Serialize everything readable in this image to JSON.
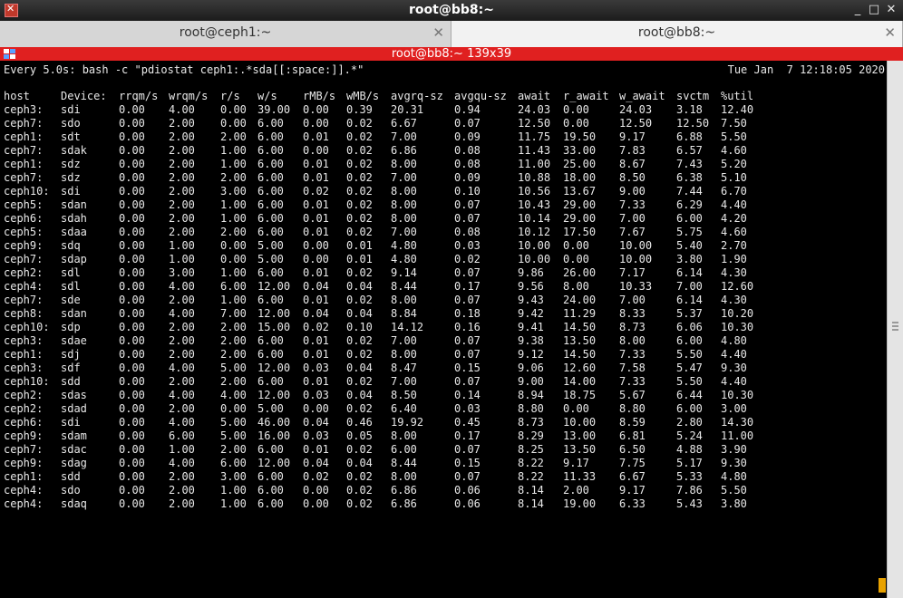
{
  "window": {
    "title": "root@bb8:~"
  },
  "tabs": [
    {
      "label": "root@ceph1:~",
      "active": false
    },
    {
      "label": "root@bb8:~",
      "active": true
    }
  ],
  "terminal": {
    "title": "root@bb8:~ 139x39",
    "command": "Every 5.0s: bash -c \"pdiostat ceph1:.*sda[[:space:]].*\"",
    "datetime": "Tue Jan  7 12:18:05 2020",
    "headers": [
      "host",
      "Device:",
      "rrqm/s",
      "wrqm/s",
      "r/s",
      "w/s",
      "rMB/s",
      "wMB/s",
      "avgrq-sz",
      "avgqu-sz",
      "await",
      "r_await",
      "w_await",
      "svctm",
      "%util"
    ],
    "rows": [
      [
        "ceph3:",
        "sdi",
        "0.00",
        "4.00",
        "0.00",
        "39.00",
        "0.00",
        "0.39",
        "20.31",
        "0.94",
        "24.03",
        "0.00",
        "24.03",
        "3.18",
        "12.40"
      ],
      [
        "ceph7:",
        "sdo",
        "0.00",
        "2.00",
        "0.00",
        "6.00",
        "0.00",
        "0.02",
        "6.67",
        "0.07",
        "12.50",
        "0.00",
        "12.50",
        "12.50",
        "7.50"
      ],
      [
        "ceph1:",
        "sdt",
        "0.00",
        "2.00",
        "2.00",
        "6.00",
        "0.01",
        "0.02",
        "7.00",
        "0.09",
        "11.75",
        "19.50",
        "9.17",
        "6.88",
        "5.50"
      ],
      [
        "ceph7:",
        "sdak",
        "0.00",
        "2.00",
        "1.00",
        "6.00",
        "0.00",
        "0.02",
        "6.86",
        "0.08",
        "11.43",
        "33.00",
        "7.83",
        "6.57",
        "4.60"
      ],
      [
        "ceph1:",
        "sdz",
        "0.00",
        "2.00",
        "1.00",
        "6.00",
        "0.01",
        "0.02",
        "8.00",
        "0.08",
        "11.00",
        "25.00",
        "8.67",
        "7.43",
        "5.20"
      ],
      [
        "ceph7:",
        "sdz",
        "0.00",
        "2.00",
        "2.00",
        "6.00",
        "0.01",
        "0.02",
        "7.00",
        "0.09",
        "10.88",
        "18.00",
        "8.50",
        "6.38",
        "5.10"
      ],
      [
        "ceph10:",
        "sdi",
        "0.00",
        "2.00",
        "3.00",
        "6.00",
        "0.02",
        "0.02",
        "8.00",
        "0.10",
        "10.56",
        "13.67",
        "9.00",
        "7.44",
        "6.70"
      ],
      [
        "ceph5:",
        "sdan",
        "0.00",
        "2.00",
        "1.00",
        "6.00",
        "0.01",
        "0.02",
        "8.00",
        "0.07",
        "10.43",
        "29.00",
        "7.33",
        "6.29",
        "4.40"
      ],
      [
        "ceph6:",
        "sdah",
        "0.00",
        "2.00",
        "1.00",
        "6.00",
        "0.01",
        "0.02",
        "8.00",
        "0.07",
        "10.14",
        "29.00",
        "7.00",
        "6.00",
        "4.20"
      ],
      [
        "ceph5:",
        "sdaa",
        "0.00",
        "2.00",
        "2.00",
        "6.00",
        "0.01",
        "0.02",
        "7.00",
        "0.08",
        "10.12",
        "17.50",
        "7.67",
        "5.75",
        "4.60"
      ],
      [
        "ceph9:",
        "sdq",
        "0.00",
        "1.00",
        "0.00",
        "5.00",
        "0.00",
        "0.01",
        "4.80",
        "0.03",
        "10.00",
        "0.00",
        "10.00",
        "5.40",
        "2.70"
      ],
      [
        "ceph7:",
        "sdap",
        "0.00",
        "1.00",
        "0.00",
        "5.00",
        "0.00",
        "0.01",
        "4.80",
        "0.02",
        "10.00",
        "0.00",
        "10.00",
        "3.80",
        "1.90"
      ],
      [
        "ceph2:",
        "sdl",
        "0.00",
        "3.00",
        "1.00",
        "6.00",
        "0.01",
        "0.02",
        "9.14",
        "0.07",
        "9.86",
        "26.00",
        "7.17",
        "6.14",
        "4.30"
      ],
      [
        "ceph4:",
        "sdl",
        "0.00",
        "4.00",
        "6.00",
        "12.00",
        "0.04",
        "0.04",
        "8.44",
        "0.17",
        "9.56",
        "8.00",
        "10.33",
        "7.00",
        "12.60"
      ],
      [
        "ceph7:",
        "sde",
        "0.00",
        "2.00",
        "1.00",
        "6.00",
        "0.01",
        "0.02",
        "8.00",
        "0.07",
        "9.43",
        "24.00",
        "7.00",
        "6.14",
        "4.30"
      ],
      [
        "ceph8:",
        "sdan",
        "0.00",
        "4.00",
        "7.00",
        "12.00",
        "0.04",
        "0.04",
        "8.84",
        "0.18",
        "9.42",
        "11.29",
        "8.33",
        "5.37",
        "10.20"
      ],
      [
        "ceph10:",
        "sdp",
        "0.00",
        "2.00",
        "2.00",
        "15.00",
        "0.02",
        "0.10",
        "14.12",
        "0.16",
        "9.41",
        "14.50",
        "8.73",
        "6.06",
        "10.30"
      ],
      [
        "ceph3:",
        "sdae",
        "0.00",
        "2.00",
        "2.00",
        "6.00",
        "0.01",
        "0.02",
        "7.00",
        "0.07",
        "9.38",
        "13.50",
        "8.00",
        "6.00",
        "4.80"
      ],
      [
        "ceph1:",
        "sdj",
        "0.00",
        "2.00",
        "2.00",
        "6.00",
        "0.01",
        "0.02",
        "8.00",
        "0.07",
        "9.12",
        "14.50",
        "7.33",
        "5.50",
        "4.40"
      ],
      [
        "ceph3:",
        "sdf",
        "0.00",
        "4.00",
        "5.00",
        "12.00",
        "0.03",
        "0.04",
        "8.47",
        "0.15",
        "9.06",
        "12.60",
        "7.58",
        "5.47",
        "9.30"
      ],
      [
        "ceph10:",
        "sdd",
        "0.00",
        "2.00",
        "2.00",
        "6.00",
        "0.01",
        "0.02",
        "7.00",
        "0.07",
        "9.00",
        "14.00",
        "7.33",
        "5.50",
        "4.40"
      ],
      [
        "ceph2:",
        "sdas",
        "0.00",
        "4.00",
        "4.00",
        "12.00",
        "0.03",
        "0.04",
        "8.50",
        "0.14",
        "8.94",
        "18.75",
        "5.67",
        "6.44",
        "10.30"
      ],
      [
        "ceph2:",
        "sdad",
        "0.00",
        "2.00",
        "0.00",
        "5.00",
        "0.00",
        "0.02",
        "6.40",
        "0.03",
        "8.80",
        "0.00",
        "8.80",
        "6.00",
        "3.00"
      ],
      [
        "ceph6:",
        "sdi",
        "0.00",
        "4.00",
        "5.00",
        "46.00",
        "0.04",
        "0.46",
        "19.92",
        "0.45",
        "8.73",
        "10.00",
        "8.59",
        "2.80",
        "14.30"
      ],
      [
        "ceph9:",
        "sdam",
        "0.00",
        "6.00",
        "5.00",
        "16.00",
        "0.03",
        "0.05",
        "8.00",
        "0.17",
        "8.29",
        "13.00",
        "6.81",
        "5.24",
        "11.00"
      ],
      [
        "ceph7:",
        "sdac",
        "0.00",
        "1.00",
        "2.00",
        "6.00",
        "0.01",
        "0.02",
        "6.00",
        "0.07",
        "8.25",
        "13.50",
        "6.50",
        "4.88",
        "3.90"
      ],
      [
        "ceph9:",
        "sdag",
        "0.00",
        "4.00",
        "6.00",
        "12.00",
        "0.04",
        "0.04",
        "8.44",
        "0.15",
        "8.22",
        "9.17",
        "7.75",
        "5.17",
        "9.30"
      ],
      [
        "ceph1:",
        "sdd",
        "0.00",
        "2.00",
        "3.00",
        "6.00",
        "0.02",
        "0.02",
        "8.00",
        "0.07",
        "8.22",
        "11.33",
        "6.67",
        "5.33",
        "4.80"
      ],
      [
        "ceph4:",
        "sdo",
        "0.00",
        "2.00",
        "1.00",
        "6.00",
        "0.00",
        "0.02",
        "6.86",
        "0.06",
        "8.14",
        "2.00",
        "9.17",
        "7.86",
        "5.50"
      ],
      [
        "ceph4:",
        "sdaq",
        "0.00",
        "2.00",
        "1.00",
        "6.00",
        "0.00",
        "0.02",
        "6.86",
        "0.06",
        "8.14",
        "19.00",
        "6.33",
        "5.43",
        "3.80"
      ]
    ]
  },
  "colors": {
    "termbar": "#e02020",
    "terminal_bg": "#000000",
    "terminal_fg": "#e8e8e8",
    "resize_grip": "#e8a200"
  }
}
